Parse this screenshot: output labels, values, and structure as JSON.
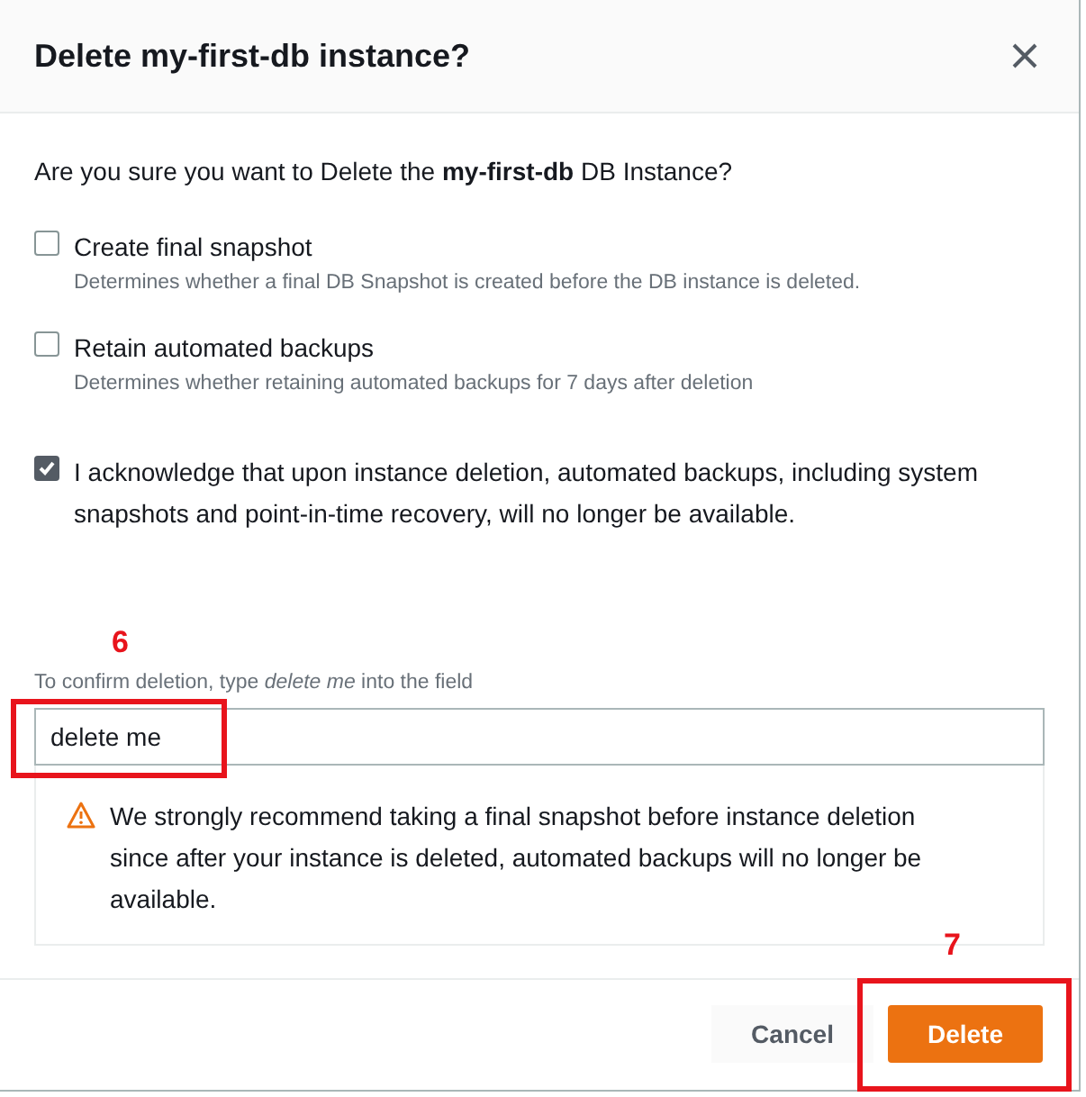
{
  "dialog": {
    "title": "Delete my-first-db instance?",
    "question": "Are you sure you want to Delete the **my-first-db** DB Instance?",
    "options": [
      {
        "label": "Create final snapshot",
        "description": "Determines whether a final DB Snapshot is created before the DB instance is deleted.",
        "checked": false
      },
      {
        "label": "Retain automated backups",
        "description": "Determines whether retaining automated backups for 7 days after deletion",
        "checked": false
      },
      {
        "label": "I acknowledge that upon instance deletion, automated backups, including system snapshots and point-in-time recovery, will no longer be available.",
        "checked": true
      }
    ],
    "confirm_label": "To confirm deletion, type *delete me* into the field",
    "confirm_value": "delete me",
    "warning": "We strongly recommend taking a final snapshot before instance deletion since after your instance is deleted, automated backups will no longer be available.",
    "buttons": [
      {
        "label": "Cancel",
        "kind": "secondary"
      },
      {
        "label": "Delete",
        "kind": "primary"
      }
    ]
  },
  "annotations": [
    {
      "number": "6"
    },
    {
      "number": "7"
    }
  ]
}
